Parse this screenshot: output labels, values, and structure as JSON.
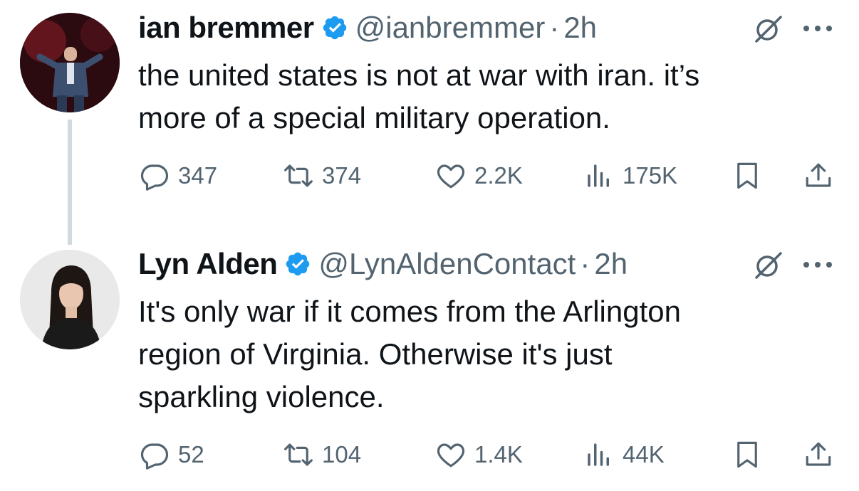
{
  "tweets": [
    {
      "name": "ian bremmer",
      "handle": "@ianbremmer",
      "separator": "·",
      "time": "2h",
      "text_lines": [
        "the united states is not at war with iran. it’s",
        "more of a special military operation."
      ],
      "stats": {
        "replies": "347",
        "reposts": "374",
        "likes": "2.2K",
        "views": "175K"
      }
    },
    {
      "name": "Lyn Alden",
      "handle": "@LynAldenContact",
      "separator": "·",
      "time": "2h",
      "text_lines": [
        "It's only war if it comes from the Arlington",
        "region of Virginia. Otherwise it's just",
        "sparkling violence."
      ],
      "stats": {
        "replies": "52",
        "reposts": "104",
        "likes": "1.4K",
        "views": "44K"
      }
    }
  ],
  "icons": [
    "verified-badge-icon",
    "grok-icon",
    "more-icon",
    "reply-icon",
    "repost-icon",
    "like-icon",
    "views-icon",
    "bookmark-icon",
    "share-icon"
  ],
  "colors": {
    "text": "#0f1419",
    "muted": "#536471",
    "verified": "#1d9bf0",
    "thread_line": "#cfd9de"
  }
}
